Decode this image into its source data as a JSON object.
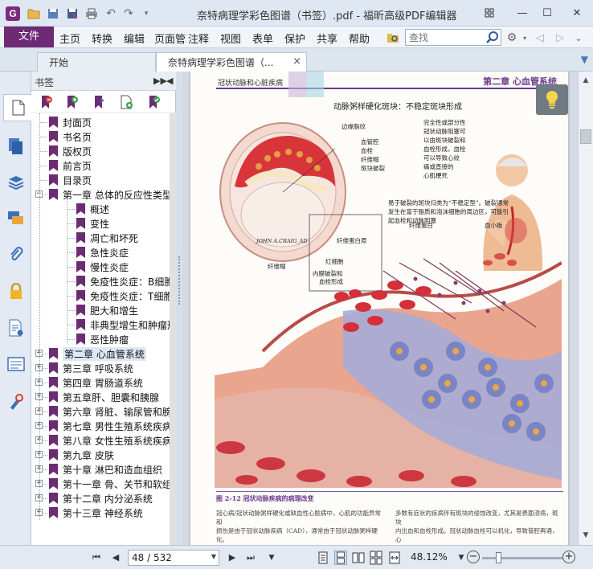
{
  "window": {
    "title": "奈特病理学彩色图谱（书签）.pdf - 福昕高级PDF编辑器",
    "logo_letter": "G",
    "minimize": "—",
    "maximize": "☐",
    "close": "✕"
  },
  "ribbon": {
    "file_label": "文件",
    "menus": [
      "主页",
      "转换",
      "编辑",
      "页面管理",
      "注释",
      "视图",
      "表单",
      "保护",
      "共享",
      "帮助"
    ],
    "search_placeholder": "查找"
  },
  "tabs": [
    {
      "label": "开始"
    },
    {
      "label": "奈特病理学彩色图谱（...",
      "close": "×"
    }
  ],
  "bookmarks": {
    "title": "书签",
    "items": [
      {
        "label": "封面页",
        "level": 1
      },
      {
        "label": "书名页",
        "level": 1
      },
      {
        "label": "版权页",
        "level": 1
      },
      {
        "label": "前言页",
        "level": 1
      },
      {
        "label": "目录页",
        "level": 1
      },
      {
        "label": "第一章 总体的反应性类型",
        "level": 1,
        "expander": "−"
      },
      {
        "label": "概述",
        "level": 2
      },
      {
        "label": "变性",
        "level": 2
      },
      {
        "label": "凋亡和坏死",
        "level": 2
      },
      {
        "label": "急性炎症",
        "level": 2
      },
      {
        "label": "慢性炎症",
        "level": 2
      },
      {
        "label": "免疫性炎症：B细胞",
        "level": 2
      },
      {
        "label": "免疫性炎症：T细胞",
        "level": 2
      },
      {
        "label": "肥大和增生",
        "level": 2
      },
      {
        "label": "非典型增生和肿瘤形成",
        "level": 2
      },
      {
        "label": "恶性肿瘤",
        "level": 2
      },
      {
        "label": "第二章 心血管系统",
        "level": 1,
        "expander": "+",
        "selected": true
      },
      {
        "label": "第三章 呼吸系统",
        "level": 1,
        "expander": "+"
      },
      {
        "label": "第四章 胃肠道系统",
        "level": 1,
        "expander": "+"
      },
      {
        "label": "第五章肝、胆囊和胰腺",
        "level": 1,
        "expander": "+"
      },
      {
        "label": "第六章 肾脏、输尿管和膀胱",
        "level": 1,
        "expander": "+"
      },
      {
        "label": "第七章 男性生殖系统疾病",
        "level": 1,
        "expander": "+"
      },
      {
        "label": "第八章 女性生殖系统疾病",
        "level": 1,
        "expander": "+"
      },
      {
        "label": "第九章 皮肤",
        "level": 1,
        "expander": "+"
      },
      {
        "label": "第十章 淋巴和造血组织",
        "level": 1,
        "expander": "+"
      },
      {
        "label": "第十一章 骨、关节和软组织",
        "level": 1,
        "expander": "+"
      },
      {
        "label": "第十二章 内分泌系统",
        "level": 1,
        "expander": "+"
      },
      {
        "label": "第十三章 神经系统",
        "level": 1,
        "expander": "+"
      }
    ]
  },
  "document": {
    "running_head": "冠状动脉和心脏疾病",
    "chapter_head": "第二章  心血管系统",
    "figure_title": "动脉粥样硬化斑块：不稳定斑块形成",
    "labels": {
      "l1": "边缘脂纹",
      "l2": "血管腔",
      "l3": "血栓",
      "l4": "纤维帽",
      "l5": "斑块破裂",
      "l6": "纤维蛋白",
      "l7": "血小板",
      "l8": "纤维蛋白原",
      "l9": "红细胞",
      "l10": "内膜破裂和",
      "l10b": "血栓形成",
      "l11": "纤维帽"
    },
    "note_right": [
      "完全性或部分性",
      "冠状动脉阻塞可",
      "以由斑块破裂和",
      "血栓形成，血栓",
      "可以导致心绞",
      "痛或直接的",
      "心肌梗死"
    ],
    "note_mid": [
      "易于破裂的斑块归类为“不稳定型”。破裂通常",
      "发生在富于脂质和泡沫细胞的周边区，可能引",
      "起血栓和动脉阻塞"
    ],
    "signature": "JOHN A.CRAIG_AD",
    "caption": "图 2-12   冠状动脉疾病的病理改变",
    "body_left": [
      "冠心病/冠状动脉粥样硬化或缺血性心脏病中，心肌的功能异常和",
      "损伤是由于冠状动脉疾病（CAD），通常由于冠状动脉粥样硬化。",
      "冠状动脉粥样硬化通过动脉粥样硬化斑块导致一支或多支冠状",
      "动脉血液进性的管腔狭窄。这些斑块通常在斑块..."
    ],
    "body_right": [
      "多数有症状的疾病伴有斑块的侵蚀改变，尤其是表面溃疡，斑块",
      "内出血和血栓形成。冠状动脉血栓可以机化，导致管腔再通，心",
      "肌缺血的非动脉粥样硬化原因包括先天性冠状动脉畸形、冠状动",
      "脉栓塞、冠状动脉血管炎（Kawasaki病）、结节性多动脉炎等等）或..."
    ]
  },
  "status": {
    "page_value": "48 / 532",
    "zoom": "48.12%",
    "zoom_fraction": 0.2
  },
  "colors": {
    "brand": "#6c2b74",
    "bookmark_flag": "#6b2c73",
    "accent_blue": "#4a78b5"
  }
}
